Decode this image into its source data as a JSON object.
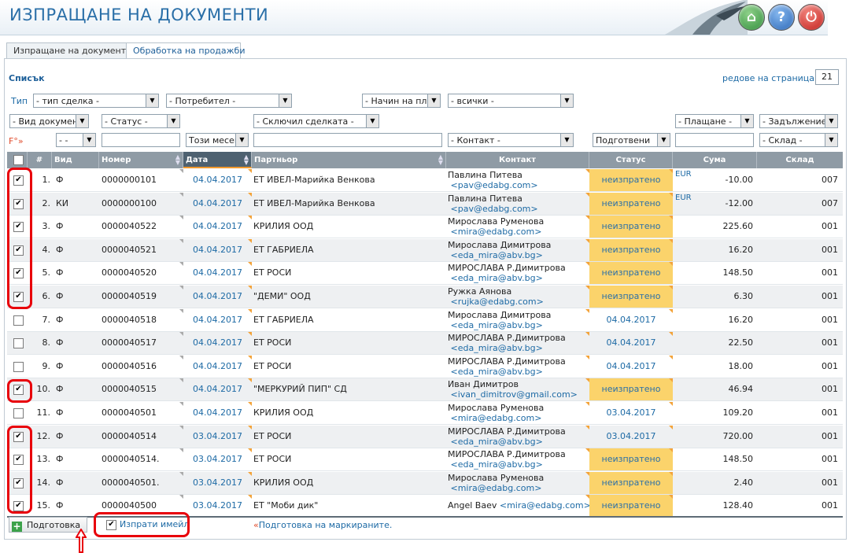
{
  "header": {
    "title": "ИЗПРАЩАНЕ НА ДОКУМЕНТИ"
  },
  "tabs": [
    {
      "label": "Изпращане на документи",
      "active": false
    },
    {
      "label": "Обработка на продажби",
      "active": true
    }
  ],
  "panel": {
    "list_title": "Списък",
    "rows_per_page_label": "редове на страница",
    "rows_per_page_value": "21"
  },
  "filters": {
    "type_label": "Тип",
    "f_label": "F°»",
    "row1": [
      "- тип сделка -",
      "- Потребител -",
      "- Начин на плащ",
      "- всички -"
    ],
    "row2": [
      "- Вид документ",
      "- Статус -",
      "- Сключил сделката -",
      "- Плащане -",
      "- Задължение -"
    ],
    "row3": [
      "- -",
      "Този месец",
      "- Контакт -",
      "Подготвени",
      "- Склад -"
    ]
  },
  "columns": [
    "#",
    "Вид",
    "Номер",
    "Дата",
    "Партньор",
    "Контакт",
    "Статус",
    "Сума",
    "Склад"
  ],
  "currency": "EUR",
  "rows": [
    {
      "n": "1.",
      "type": "Ф",
      "num": "0000000101",
      "date": "04.04.2017",
      "partner": "ЕТ ИВЕЛ-Марийка Венкова",
      "cname": "Павлина Питева",
      "cemail": "<pav@edabg.com>",
      "status": "неизпратено",
      "pending": true,
      "sum": "-10.00",
      "store": "007",
      "checked": true
    },
    {
      "n": "2.",
      "type": "КИ",
      "num": "0000000100",
      "date": "04.04.2017",
      "partner": "ЕТ ИВЕЛ-Марийка Венкова",
      "cname": "Павлина Питева",
      "cemail": "<pav@edabg.com>",
      "status": "неизпратено",
      "pending": true,
      "sum": "-12.00",
      "store": "007",
      "checked": true
    },
    {
      "n": "3.",
      "type": "Ф",
      "num": "0000040522",
      "date": "04.04.2017",
      "partner": "КРИЛИЯ ООД",
      "cname": "Мирослава Руменова",
      "cemail": "<mira@edabg.com>",
      "status": "неизпратено",
      "pending": true,
      "sum": "225.60",
      "store": "001",
      "checked": true
    },
    {
      "n": "4.",
      "type": "Ф",
      "num": "0000040521",
      "date": "04.04.2017",
      "partner": "ЕТ ГАБРИЕЛА",
      "cname": "Мирослава Димитрова",
      "cemail": "<eda_mira@abv.bg>",
      "status": "неизпратено",
      "pending": true,
      "sum": "16.20",
      "store": "001",
      "checked": true
    },
    {
      "n": "5.",
      "type": "Ф",
      "num": "0000040520",
      "date": "04.04.2017",
      "partner": "ЕТ РОСИ",
      "cname": "МИРОСЛАВА Р.Димитрова",
      "cemail": "<eda_mira@abv.bg>",
      "status": "неизпратено",
      "pending": true,
      "sum": "148.50",
      "store": "001",
      "checked": true
    },
    {
      "n": "6.",
      "type": "Ф",
      "num": "0000040519",
      "date": "04.04.2017",
      "partner": "\"ДЕМИ\" ООД",
      "cname": "Ружка Аянова",
      "cemail": "<rujka@edabg.com>",
      "status": "неизпратено",
      "pending": true,
      "sum": "6.30",
      "store": "001",
      "checked": true
    },
    {
      "n": "7.",
      "type": "Ф",
      "num": "0000040518",
      "date": "04.04.2017",
      "partner": "ЕТ ГАБРИЕЛА",
      "cname": "Мирослава Димитрова",
      "cemail": "<eda_mira@abv.bg>",
      "status": "04.04.2017",
      "pending": false,
      "sum": "16.20",
      "store": "001",
      "checked": false
    },
    {
      "n": "8.",
      "type": "Ф",
      "num": "0000040517",
      "date": "04.04.2017",
      "partner": "ЕТ РОСИ",
      "cname": "МИРОСЛАВА Р.Димитрова",
      "cemail": "<eda_mira@abv.bg>",
      "status": "04.04.2017",
      "pending": false,
      "sum": "22.50",
      "store": "001",
      "checked": false
    },
    {
      "n": "9.",
      "type": "Ф",
      "num": "0000040516",
      "date": "04.04.2017",
      "partner": "ЕТ РОСИ",
      "cname": "МИРОСЛАВА Р.Димитрова",
      "cemail": "<eda_mira@abv.bg>",
      "status": "04.04.2017",
      "pending": false,
      "sum": "18.00",
      "store": "001",
      "checked": false
    },
    {
      "n": "10.",
      "type": "Ф",
      "num": "0000040515",
      "date": "04.04.2017",
      "partner": "\"МЕРКУРИЙ ПИП\" СД",
      "cname": "Иван Димитров",
      "cemail": "<ivan_dimitrov@gmail.com>",
      "status": "неизпратено",
      "pending": true,
      "sum": "46.94",
      "store": "001",
      "checked": true
    },
    {
      "n": "11.",
      "type": "Ф",
      "num": "0000040501",
      "date": "04.04.2017",
      "partner": "КРИЛИЯ ООД",
      "cname": "Мирослава Руменова",
      "cemail": "<mira@edabg.com>",
      "status": "03.04.2017",
      "pending": false,
      "sum": "109.20",
      "store": "001",
      "checked": false
    },
    {
      "n": "12.",
      "type": "Ф",
      "num": "0000040514",
      "date": "03.04.2017",
      "partner": "ЕТ РОСИ",
      "cname": "МИРОСЛАВА Р.Димитрова",
      "cemail": "<eda_mira@abv.bg>",
      "status": "03.04.2017",
      "pending": false,
      "sum": "720.00",
      "store": "001",
      "checked": true
    },
    {
      "n": "13.",
      "type": "Ф",
      "num": "0000040514.",
      "date": "03.04.2017",
      "partner": "ЕТ РОСИ",
      "cname": "МИРОСЛАВА Р.Димитрова",
      "cemail": "<eda_mira@abv.bg>",
      "status": "неизпратено",
      "pending": true,
      "sum": "148.50",
      "store": "001",
      "checked": true
    },
    {
      "n": "14.",
      "type": "Ф",
      "num": "0000040501.",
      "date": "03.04.2017",
      "partner": "КРИЛИЯ ООД",
      "cname": "Мирослава Руменова",
      "cemail": "<mira@edabg.com>",
      "status": "неизпратено",
      "pending": true,
      "sum": "2.40",
      "store": "001",
      "checked": true
    },
    {
      "n": "15.",
      "type": "Ф",
      "num": "0000040500",
      "date": "03.04.2017",
      "partner": "ЕТ \"Моби дик\"",
      "cname": "Angel Baev",
      "cemail": "<mira@edabg.com>",
      "status": "неизпратено",
      "pending": true,
      "sum": "128.40",
      "store": "001",
      "checked": true,
      "inline_contact": true
    }
  ],
  "footer": {
    "prepare_button": "Подготовка",
    "send_email_label": "Изпрати имейл",
    "send_email_checked": true,
    "hint_prefix": "«",
    "hint": "Подготовка на маркираните."
  },
  "icons": {
    "home": "home-icon",
    "help": "help-icon",
    "power": "power-icon"
  },
  "colors": {
    "accent": "#2a6fa8",
    "pending": "#fbd36b",
    "header_bg": "#8f9ba5",
    "highlight": "#e8000a"
  }
}
